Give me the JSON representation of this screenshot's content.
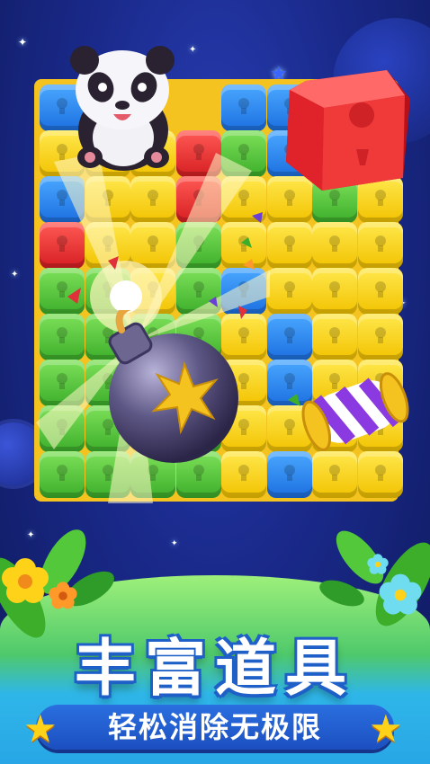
{
  "promo": {
    "title": "丰富道具",
    "subtitle": "轻松消除无极限"
  },
  "board": {
    "rows": [
      [
        "blue",
        "blue",
        "",
        "",
        "blue",
        "blue",
        "",
        ""
      ],
      [
        "yellow",
        "yellow",
        "yellow",
        "red",
        "green",
        "blue",
        "blue",
        "blue"
      ],
      [
        "blue",
        "yellow",
        "yellow",
        "red",
        "yellow",
        "yellow",
        "green",
        "yellow"
      ],
      [
        "red",
        "yellow",
        "yellow",
        "green",
        "yellow",
        "yellow",
        "yellow",
        "yellow"
      ],
      [
        "green",
        "green",
        "yellow",
        "green",
        "blue",
        "yellow",
        "yellow",
        "yellow"
      ],
      [
        "green",
        "green",
        "green",
        "green",
        "yellow",
        "blue",
        "yellow",
        "yellow"
      ],
      [
        "green",
        "green",
        "yellow",
        "yellow",
        "yellow",
        "blue",
        "yellow",
        "yellow"
      ],
      [
        "green",
        "green",
        "yellow",
        "green",
        "yellow",
        "yellow",
        "yellow",
        "yellow"
      ],
      [
        "green",
        "green",
        "green",
        "green",
        "yellow",
        "blue",
        "yellow",
        "yellow"
      ]
    ]
  },
  "items": {
    "mascot": "panda-icon",
    "bomb": "bomb-icon",
    "red_block": "red-block-icon",
    "candy": "striped-candy-icon"
  },
  "colors": {
    "background": "#1a2a8c",
    "frame": "#f5c320",
    "title_outline": "#1e5fc8",
    "star": "#ffd21a"
  }
}
